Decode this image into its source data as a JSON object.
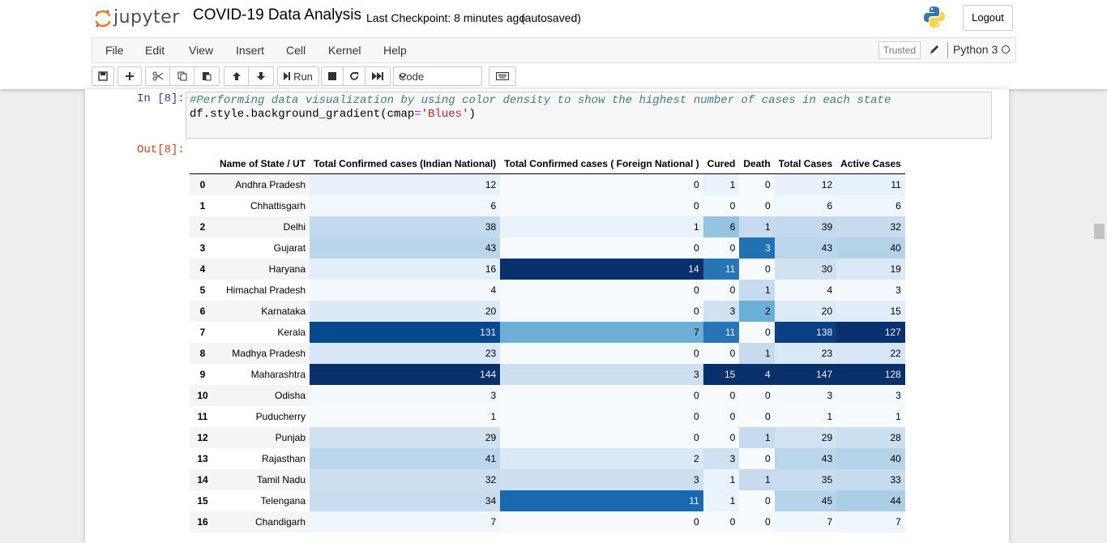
{
  "header": {
    "logo_text": "jupyter",
    "notebook_name": "COVID-19 Data Analysis",
    "checkpoint": "Last Checkpoint: 8 minutes ago",
    "autosave": "(autosaved)",
    "logout_label": "Logout"
  },
  "menu": {
    "items": [
      "File",
      "Edit",
      "View",
      "Insert",
      "Cell",
      "Kernel",
      "Help"
    ],
    "trusted_label": "Trusted",
    "kernel_name": "Python 3"
  },
  "toolbar": {
    "run_label": "Run",
    "cell_type": "Code",
    "icons": [
      "save-icon",
      "plus-icon",
      "cut-icon",
      "copy-icon",
      "paste-icon",
      "move-up-icon",
      "move-down-icon",
      "run-icon",
      "stop-icon",
      "restart-icon",
      "fast-forward-icon",
      "keyboard-icon"
    ]
  },
  "cell": {
    "in_prompt": "In [8]:",
    "out_prompt": "Out[8]:",
    "code_comment": "#Performing data visualization by using color density to show the highest number of cases in each state",
    "code_prefix": "df.style.background_gradient(cmap",
    "code_eq": "=",
    "code_string": "'Blues'",
    "code_suffix": ")"
  },
  "table": {
    "columns": [
      "Name of State / UT",
      "Total Confirmed cases (Indian National)",
      "Total Confirmed cases ( Foreign National )",
      "Cured",
      "Death",
      "Total Cases",
      "Active Cases"
    ],
    "rows": [
      {
        "idx": "0",
        "state": "Andhra Pradesh",
        "vals": [
          12,
          0,
          1,
          0,
          12,
          11
        ]
      },
      {
        "idx": "1",
        "state": "Chhattisgarh",
        "vals": [
          6,
          0,
          0,
          0,
          6,
          6
        ]
      },
      {
        "idx": "2",
        "state": "Delhi",
        "vals": [
          38,
          1,
          6,
          1,
          39,
          32
        ]
      },
      {
        "idx": "3",
        "state": "Gujarat",
        "vals": [
          43,
          0,
          0,
          3,
          43,
          40
        ]
      },
      {
        "idx": "4",
        "state": "Haryana",
        "vals": [
          16,
          14,
          11,
          0,
          30,
          19
        ]
      },
      {
        "idx": "5",
        "state": "Himachal Pradesh",
        "vals": [
          4,
          0,
          0,
          1,
          4,
          3
        ]
      },
      {
        "idx": "6",
        "state": "Karnataka",
        "vals": [
          20,
          0,
          3,
          2,
          20,
          15
        ]
      },
      {
        "idx": "7",
        "state": "Kerala",
        "vals": [
          131,
          7,
          11,
          0,
          138,
          127
        ]
      },
      {
        "idx": "8",
        "state": "Madhya Pradesh",
        "vals": [
          23,
          0,
          0,
          1,
          23,
          22
        ]
      },
      {
        "idx": "9",
        "state": "Maharashtra",
        "vals": [
          144,
          3,
          15,
          4,
          147,
          128
        ]
      },
      {
        "idx": "10",
        "state": "Odisha",
        "vals": [
          3,
          0,
          0,
          0,
          3,
          3
        ]
      },
      {
        "idx": "11",
        "state": "Puducherry",
        "vals": [
          1,
          0,
          0,
          0,
          1,
          1
        ]
      },
      {
        "idx": "12",
        "state": "Punjab",
        "vals": [
          29,
          0,
          0,
          1,
          29,
          28
        ]
      },
      {
        "idx": "13",
        "state": "Rajasthan",
        "vals": [
          41,
          2,
          3,
          0,
          43,
          40
        ]
      },
      {
        "idx": "14",
        "state": "Tamil Nadu",
        "vals": [
          32,
          3,
          1,
          1,
          35,
          33
        ]
      },
      {
        "idx": "15",
        "state": "Telengana",
        "vals": [
          34,
          11,
          1,
          0,
          45,
          44
        ]
      },
      {
        "idx": "16",
        "state": "Chandigarh",
        "vals": [
          7,
          0,
          0,
          0,
          7,
          7
        ]
      }
    ],
    "gradient": {
      "light": "#f7fbff",
      "mid1": "#c6dbef",
      "mid2": "#6baed6",
      "mid3": "#2171b5",
      "dark": "#08306b"
    }
  }
}
